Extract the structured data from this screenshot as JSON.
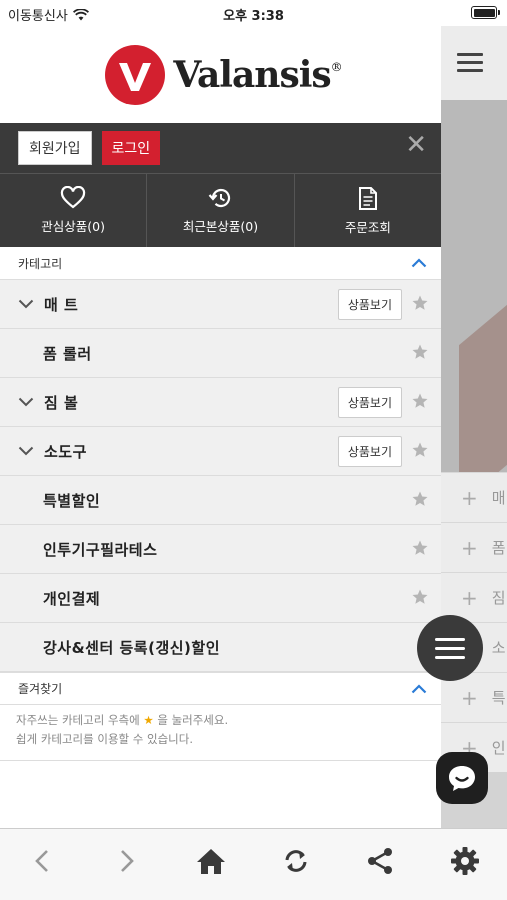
{
  "status_bar": {
    "carrier": "이동통신사",
    "time": "오후 3:38"
  },
  "brand": {
    "name": "Valansis",
    "reg": "®",
    "color": "#d3202f"
  },
  "auth": {
    "join_label": "회원가입",
    "login_label": "로그인",
    "close": "✕"
  },
  "quick_links": [
    {
      "label": "관심상품(0)",
      "icon": "heart-icon"
    },
    {
      "label": "최근본상품(0)",
      "icon": "history-icon"
    },
    {
      "label": "주문조회",
      "icon": "document-icon"
    }
  ],
  "category_section": {
    "title": "카테고리"
  },
  "categories": [
    {
      "label": "매 트",
      "expandable": true,
      "view_label": "상품보기"
    },
    {
      "label": "폼 롤러",
      "expandable": false
    },
    {
      "label": "짐 볼",
      "expandable": true,
      "view_label": "상품보기"
    },
    {
      "label": "소도구",
      "expandable": true,
      "view_label": "상품보기"
    },
    {
      "label": "특별할인",
      "expandable": false
    },
    {
      "label": "인투기구필라테스",
      "expandable": false
    },
    {
      "label": "개인결제",
      "expandable": false
    },
    {
      "label": "강사&센터 등록(갱신)할인",
      "expandable": false
    }
  ],
  "favorites": {
    "title": "즐겨찾기",
    "line1_pre": "자주쓰는 카테고리 우측에",
    "line1_star": "★",
    "line1_post": "을 눌러주세요.",
    "line2": "쉽게 카테고리를 이용할 수 있습니다."
  },
  "background_rows": [
    "매",
    "폼",
    "짐",
    "소",
    "특",
    "인"
  ],
  "toolbar": [
    "back-icon",
    "forward-icon",
    "home-icon",
    "refresh-icon",
    "share-icon",
    "settings-icon"
  ]
}
